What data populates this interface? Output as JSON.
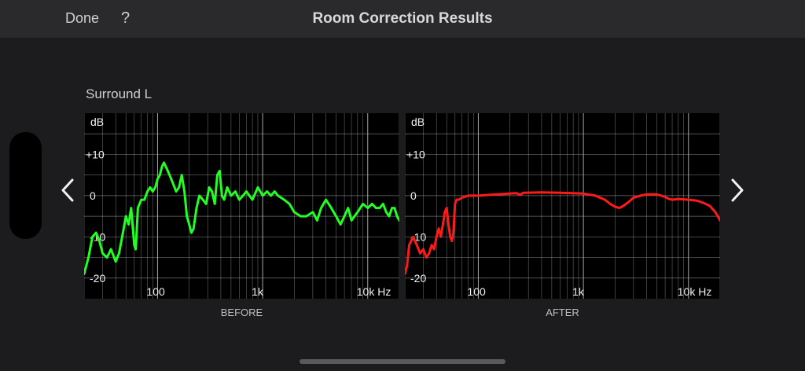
{
  "header": {
    "done_label": "Done",
    "help_label": "?",
    "title": "Room Correction Results"
  },
  "channel": {
    "name": "Surround L"
  },
  "nav": {
    "prev_icon": "chevron-left-icon",
    "next_icon": "chevron-right-icon"
  },
  "colors": {
    "background": "#1c1c1e",
    "topbar": "#2a2a2c",
    "before_line": "#22ff22",
    "after_line": "#ff1a1a",
    "grid": "#b8b8b8"
  },
  "axis": {
    "y_unit": "dB",
    "y_ticks": [
      "+10",
      "0",
      "-10",
      "-20"
    ],
    "x_ticks": [
      "100",
      "1k",
      "10k Hz"
    ]
  },
  "chart_data": [
    {
      "type": "line",
      "title": "BEFORE",
      "x_scale": "log",
      "xlim": [
        20,
        20000
      ],
      "ylim": [
        -25,
        20
      ],
      "ylabel": "dB",
      "x_tick_labels": [
        "100",
        "1k",
        "10k Hz"
      ],
      "y_tick_labels": [
        "+10",
        "0",
        "-10",
        "-20"
      ],
      "grid": true,
      "series": [
        {
          "color": "#22ff22",
          "points": [
            [
              20,
              -19
            ],
            [
              22,
              -15
            ],
            [
              24,
              -10
            ],
            [
              26,
              -9
            ],
            [
              28,
              -11
            ],
            [
              30,
              -14
            ],
            [
              33,
              -15
            ],
            [
              36,
              -13
            ],
            [
              40,
              -16
            ],
            [
              43,
              -14
            ],
            [
              46,
              -10
            ],
            [
              50,
              -5
            ],
            [
              53,
              -7
            ],
            [
              56,
              -3
            ],
            [
              60,
              -12
            ],
            [
              62,
              -13
            ],
            [
              65,
              -3
            ],
            [
              70,
              -1
            ],
            [
              75,
              -1
            ],
            [
              80,
              1
            ],
            [
              85,
              2
            ],
            [
              90,
              1
            ],
            [
              95,
              2
            ],
            [
              100,
              4
            ],
            [
              105,
              5
            ],
            [
              110,
              7
            ],
            [
              115,
              8
            ],
            [
              120,
              7
            ],
            [
              125,
              6
            ],
            [
              130,
              5
            ],
            [
              140,
              3
            ],
            [
              150,
              1
            ],
            [
              160,
              2
            ],
            [
              170,
              5
            ],
            [
              180,
              1
            ],
            [
              190,
              -5
            ],
            [
              200,
              -7
            ],
            [
              210,
              -9
            ],
            [
              220,
              -8
            ],
            [
              235,
              -3
            ],
            [
              250,
              0
            ],
            [
              270,
              -1
            ],
            [
              290,
              -2
            ],
            [
              310,
              2
            ],
            [
              330,
              1
            ],
            [
              350,
              -2
            ],
            [
              370,
              5
            ],
            [
              390,
              6
            ],
            [
              410,
              0
            ],
            [
              430,
              -1
            ],
            [
              460,
              2
            ],
            [
              500,
              0
            ],
            [
              550,
              1
            ],
            [
              600,
              -1
            ],
            [
              650,
              0
            ],
            [
              700,
              1
            ],
            [
              800,
              -1
            ],
            [
              900,
              2
            ],
            [
              1000,
              0
            ],
            [
              1100,
              1
            ],
            [
              1200,
              0
            ],
            [
              1300,
              1
            ],
            [
              1400,
              0
            ],
            [
              1600,
              -1
            ],
            [
              1800,
              -2
            ],
            [
              2000,
              -4
            ],
            [
              2300,
              -5
            ],
            [
              2600,
              -5
            ],
            [
              3000,
              -4
            ],
            [
              3300,
              -6
            ],
            [
              3600,
              -3
            ],
            [
              4000,
              -1
            ],
            [
              4500,
              -3
            ],
            [
              5000,
              -5
            ],
            [
              5500,
              -7
            ],
            [
              6000,
              -5
            ],
            [
              6500,
              -3
            ],
            [
              7000,
              -6
            ],
            [
              8000,
              -4
            ],
            [
              9000,
              -2
            ],
            [
              10000,
              -3
            ],
            [
              11000,
              -2
            ],
            [
              12000,
              -3
            ],
            [
              13000,
              -3
            ],
            [
              14000,
              -2
            ],
            [
              15000,
              -4
            ],
            [
              16000,
              -5
            ],
            [
              17000,
              -3
            ],
            [
              18000,
              -3
            ],
            [
              19000,
              -5
            ],
            [
              20000,
              -6
            ]
          ]
        }
      ]
    },
    {
      "type": "line",
      "title": "AFTER",
      "x_scale": "log",
      "xlim": [
        20,
        20000
      ],
      "ylim": [
        -25,
        20
      ],
      "ylabel": "dB",
      "x_tick_labels": [
        "100",
        "1k",
        "10k Hz"
      ],
      "y_tick_labels": [
        "+10",
        "0",
        "-10",
        "-20"
      ],
      "grid": true,
      "series": [
        {
          "color": "#ff1a1a",
          "points": [
            [
              20,
              -19
            ],
            [
              21,
              -17
            ],
            [
              22,
              -12
            ],
            [
              24,
              -10
            ],
            [
              26,
              -12
            ],
            [
              28,
              -14
            ],
            [
              30,
              -13
            ],
            [
              32,
              -15
            ],
            [
              34,
              -14
            ],
            [
              36,
              -12
            ],
            [
              38,
              -13
            ],
            [
              40,
              -10
            ],
            [
              42,
              -8
            ],
            [
              44,
              -10
            ],
            [
              46,
              -7
            ],
            [
              48,
              -4
            ],
            [
              50,
              -3
            ],
            [
              52,
              -7
            ],
            [
              54,
              -10
            ],
            [
              56,
              -11
            ],
            [
              58,
              -9
            ],
            [
              60,
              -2
            ],
            [
              62,
              -1
            ],
            [
              65,
              -1
            ],
            [
              70,
              -0.5
            ],
            [
              80,
              0
            ],
            [
              100,
              0
            ],
            [
              150,
              0.3
            ],
            [
              200,
              0.5
            ],
            [
              230,
              0.6
            ],
            [
              250,
              0.2
            ],
            [
              270,
              0.7
            ],
            [
              400,
              0.8
            ],
            [
              600,
              0.7
            ],
            [
              1000,
              0.5
            ],
            [
              1300,
              0
            ],
            [
              1600,
              -1
            ],
            [
              1800,
              -2
            ],
            [
              2000,
              -2.7
            ],
            [
              2200,
              -3
            ],
            [
              2400,
              -2.5
            ],
            [
              2700,
              -1.5
            ],
            [
              3000,
              -0.5
            ],
            [
              3500,
              0
            ],
            [
              4000,
              0.3
            ],
            [
              5000,
              0.3
            ],
            [
              5500,
              0
            ],
            [
              6000,
              -0.3
            ],
            [
              6500,
              -0.8
            ],
            [
              7000,
              -1
            ],
            [
              8000,
              -0.8
            ],
            [
              10000,
              -1
            ],
            [
              12000,
              -1.2
            ],
            [
              14000,
              -1.8
            ],
            [
              16000,
              -2.5
            ],
            [
              18000,
              -4
            ],
            [
              20000,
              -6
            ]
          ]
        }
      ]
    }
  ]
}
